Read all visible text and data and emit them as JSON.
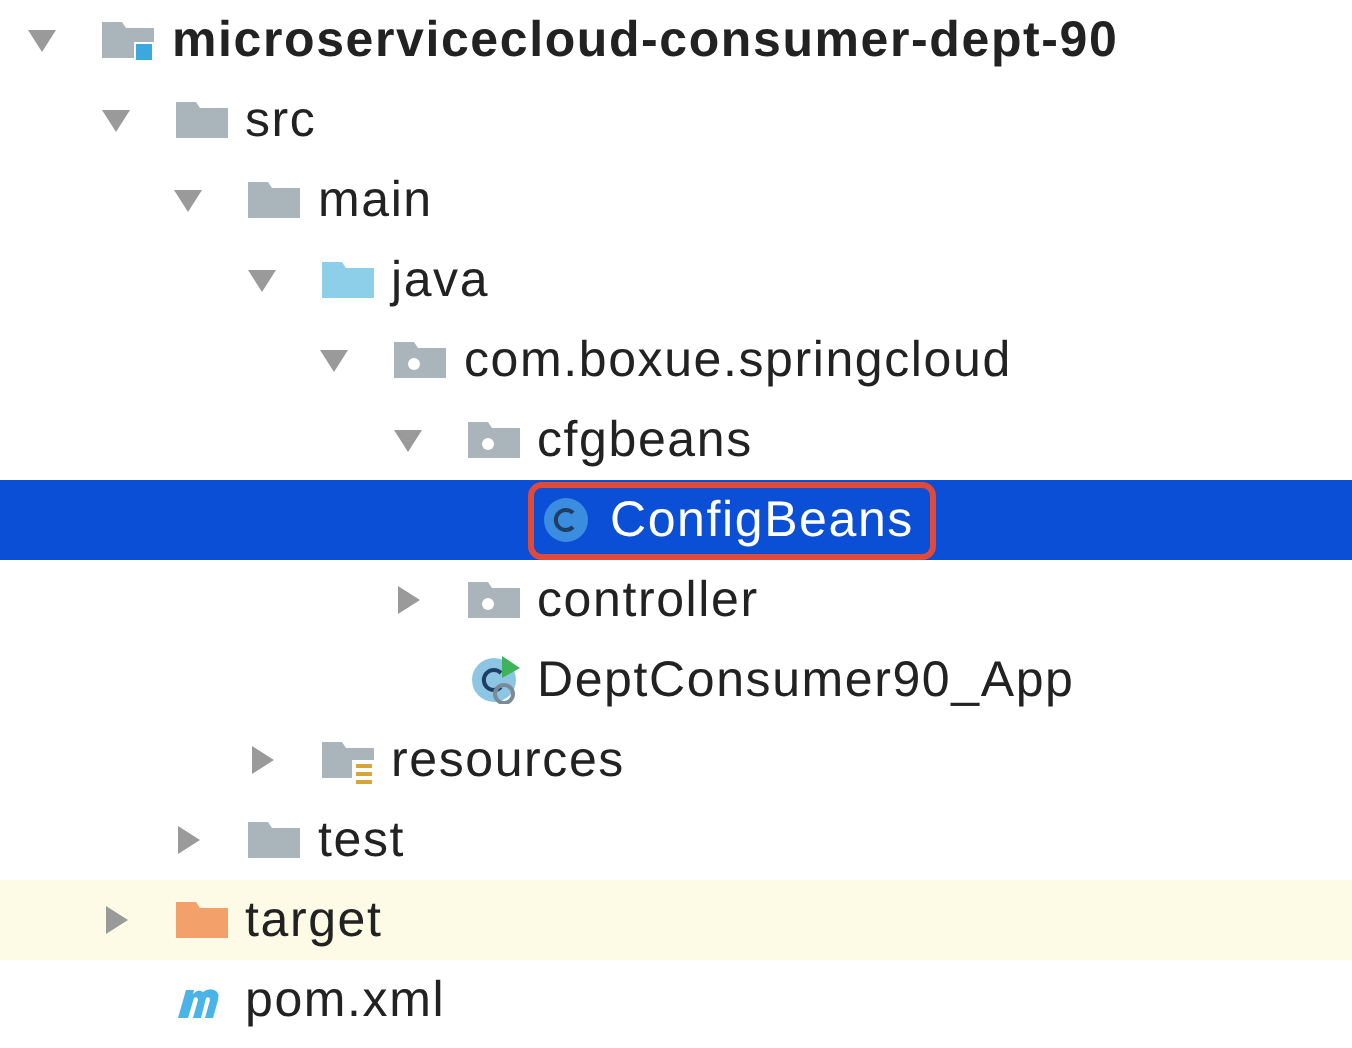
{
  "tree": [
    {
      "label": "microservicecloud-consumer-dept-90",
      "kind": "module",
      "expanded": true,
      "selected": false,
      "highlighted": false,
      "annotated": false,
      "children": [
        {
          "label": "src",
          "kind": "folder",
          "expanded": true,
          "selected": false,
          "highlighted": false,
          "annotated": false,
          "children": [
            {
              "label": "main",
              "kind": "folder",
              "expanded": true,
              "selected": false,
              "highlighted": false,
              "annotated": false,
              "children": [
                {
                  "label": "java",
                  "kind": "source-folder",
                  "expanded": true,
                  "selected": false,
                  "highlighted": false,
                  "annotated": false,
                  "children": [
                    {
                      "label": "com.boxue.springcloud",
                      "kind": "package",
                      "expanded": true,
                      "selected": false,
                      "highlighted": false,
                      "annotated": false,
                      "children": [
                        {
                          "label": "cfgbeans",
                          "kind": "package",
                          "expanded": true,
                          "selected": false,
                          "highlighted": false,
                          "annotated": false,
                          "children": [
                            {
                              "label": "ConfigBeans",
                              "kind": "class",
                              "selected": true,
                              "highlighted": false,
                              "annotated": true
                            }
                          ]
                        },
                        {
                          "label": "controller",
                          "kind": "package",
                          "expanded": false,
                          "selected": false,
                          "highlighted": false,
                          "annotated": false
                        },
                        {
                          "label": "DeptConsumer90_App",
                          "kind": "app-class",
                          "selected": false,
                          "highlighted": false,
                          "annotated": false
                        }
                      ]
                    }
                  ]
                },
                {
                  "label": "resources",
                  "kind": "resources",
                  "expanded": false,
                  "selected": false,
                  "highlighted": false,
                  "annotated": false
                }
              ]
            },
            {
              "label": "test",
              "kind": "folder",
              "expanded": false,
              "selected": false,
              "highlighted": false,
              "annotated": false
            }
          ]
        },
        {
          "label": "target",
          "kind": "excluded",
          "expanded": false,
          "selected": false,
          "highlighted": true,
          "annotated": false
        },
        {
          "label": "pom.xml",
          "kind": "maven",
          "selected": false,
          "highlighted": false,
          "annotated": false
        }
      ]
    }
  ]
}
